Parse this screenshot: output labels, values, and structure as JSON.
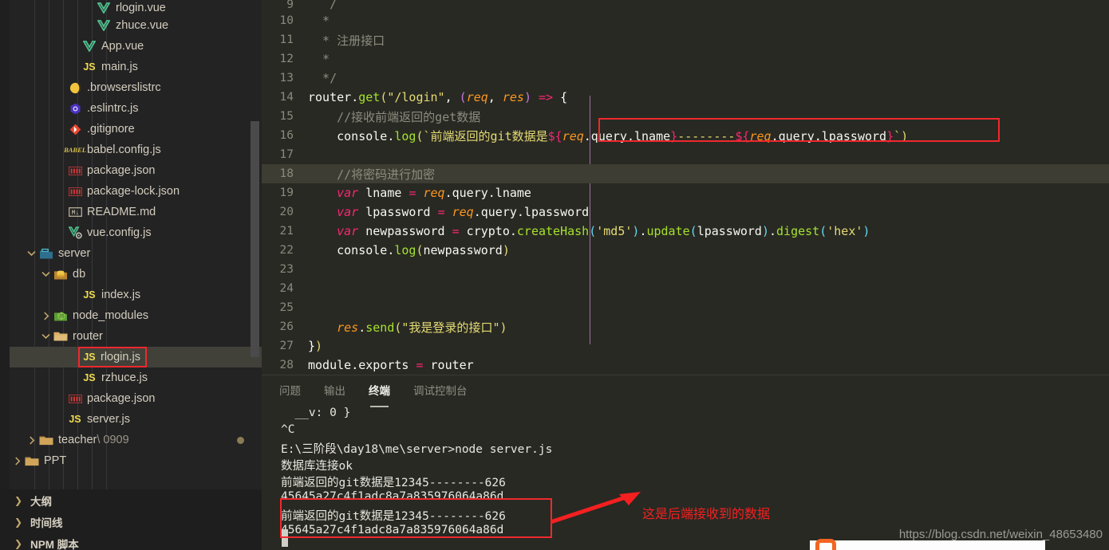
{
  "sidebar": {
    "tree": [
      {
        "label": "rlogin.vue",
        "icon": "vue-icon",
        "indent": 6,
        "twisty": "",
        "cut": true,
        "selected": false
      },
      {
        "label": "zhuce.vue",
        "icon": "vue-icon",
        "indent": 6,
        "twisty": "",
        "selected": false
      },
      {
        "label": "App.vue",
        "icon": "vue-icon",
        "indent": 5,
        "twisty": "",
        "selected": false
      },
      {
        "label": "main.js",
        "icon": "js-icon",
        "indent": 5,
        "twisty": "",
        "selected": false
      },
      {
        "label": ".browserslistrc",
        "icon": "browserslist-icon",
        "indent": 4,
        "twisty": "",
        "selected": false
      },
      {
        "label": ".eslintrc.js",
        "icon": "eslint-icon",
        "indent": 4,
        "twisty": "",
        "selected": false
      },
      {
        "label": ".gitignore",
        "icon": "git-icon",
        "indent": 4,
        "twisty": "",
        "selected": false
      },
      {
        "label": "babel.config.js",
        "icon": "babel-icon",
        "indent": 4,
        "twisty": "",
        "selected": false
      },
      {
        "label": "package.json",
        "icon": "npm-icon",
        "indent": 4,
        "twisty": "",
        "selected": false
      },
      {
        "label": "package-lock.json",
        "icon": "npm-icon",
        "indent": 4,
        "twisty": "",
        "selected": false
      },
      {
        "label": "README.md",
        "icon": "markdown-icon",
        "indent": 4,
        "twisty": "",
        "selected": false
      },
      {
        "label": "vue.config.js",
        "icon": "vue-config-icon",
        "indent": 4,
        "twisty": "",
        "selected": false
      },
      {
        "label": "server",
        "icon": "folder-server-icon",
        "indent": 2,
        "twisty": "chevron-down-icon",
        "selected": false
      },
      {
        "label": "db",
        "icon": "folder-db-icon",
        "indent": 3,
        "twisty": "chevron-down-icon",
        "selected": false
      },
      {
        "label": "index.js",
        "icon": "js-icon",
        "indent": 5,
        "twisty": "",
        "selected": false
      },
      {
        "label": "node_modules",
        "icon": "folder-node-icon",
        "indent": 3,
        "twisty": "chevron-right-icon",
        "selected": false
      },
      {
        "label": "router",
        "icon": "folder-open-icon",
        "indent": 3,
        "twisty": "chevron-down-icon",
        "selected": false
      },
      {
        "label": "rlogin.js",
        "icon": "js-icon",
        "indent": 5,
        "twisty": "",
        "selected": true,
        "outlined": true
      },
      {
        "label": "rzhuce.js",
        "icon": "js-icon",
        "indent": 5,
        "twisty": "",
        "selected": false
      },
      {
        "label": "package.json",
        "icon": "npm-icon",
        "indent": 4,
        "twisty": "",
        "selected": false
      },
      {
        "label": "server.js",
        "icon": "js-icon",
        "indent": 4,
        "twisty": "",
        "selected": false
      },
      {
        "label": "teacher",
        "label_dim": " \\ 0909",
        "icon": "folder-icon",
        "indent": 2,
        "twisty": "chevron-right-icon",
        "selected": false,
        "dirty_dot": true
      },
      {
        "label": "PPT",
        "icon": "folder-icon",
        "indent": 1,
        "twisty": "chevron-right-icon",
        "selected": false
      }
    ],
    "collapsed_sections": [
      {
        "label": "大纲",
        "twisty": "chevron-right-icon"
      },
      {
        "label": "时间线",
        "twisty": "chevron-right-icon"
      },
      {
        "label": "NPM 脚本",
        "twisty": "chevron-right-icon"
      }
    ]
  },
  "editor": {
    "first_line_number": 9,
    "active_line": 18,
    "lines": [
      {
        "n": 9,
        "segs": [
          {
            "t": "  ",
            "c": "t-plain"
          },
          {
            "t": " /",
            "c": "t-cmt"
          }
        ]
      },
      {
        "n": 10,
        "segs": [
          {
            "t": " ",
            "c": "t-plain"
          },
          {
            "t": " * ",
            "c": "t-cmt"
          }
        ]
      },
      {
        "n": 11,
        "segs": [
          {
            "t": " ",
            "c": "t-plain"
          },
          {
            "t": " * 注册接口",
            "c": "t-cmt"
          }
        ]
      },
      {
        "n": 12,
        "segs": [
          {
            "t": " ",
            "c": "t-plain"
          },
          {
            "t": " *",
            "c": "t-cmt"
          }
        ]
      },
      {
        "n": 13,
        "segs": [
          {
            "t": " ",
            "c": "t-plain"
          },
          {
            "t": " */",
            "c": "t-cmt"
          }
        ]
      },
      {
        "n": 14,
        "segs": [
          {
            "t": "router",
            "c": "t-plain"
          },
          {
            "t": ".",
            "c": "t-punct"
          },
          {
            "t": "get",
            "c": "t-fn"
          },
          {
            "t": "(",
            "c": "t-paren1"
          },
          {
            "t": "\"/login\"",
            "c": "t-str"
          },
          {
            "t": ", ",
            "c": "t-punct"
          },
          {
            "t": "(",
            "c": "t-paren2"
          },
          {
            "t": "req",
            "c": "t-param"
          },
          {
            "t": ", ",
            "c": "t-punct"
          },
          {
            "t": "res",
            "c": "t-param"
          },
          {
            "t": ")",
            "c": "t-paren2"
          },
          {
            "t": " => ",
            "c": "t-arrow"
          },
          {
            "t": "{",
            "c": "t-brace"
          }
        ]
      },
      {
        "n": 15,
        "segs": [
          {
            "t": "    //接收前端返回的get数据",
            "c": "t-cmt"
          }
        ]
      },
      {
        "n": 16,
        "segs": [
          {
            "t": "    console",
            "c": "t-plain"
          },
          {
            "t": ".",
            "c": "t-punct"
          },
          {
            "t": "log",
            "c": "t-fn"
          },
          {
            "t": "(",
            "c": "t-paren1"
          },
          {
            "t": "`前端返回的git数据是",
            "c": "t-str"
          },
          {
            "t": "$",
            "c": "t-dollar"
          },
          {
            "t": "{",
            "c": "t-key"
          },
          {
            "t": "req",
            "c": "t-param"
          },
          {
            "t": ".query.lname",
            "c": "t-plain"
          },
          {
            "t": "}",
            "c": "t-key"
          },
          {
            "t": "--------",
            "c": "t-str"
          },
          {
            "t": "$",
            "c": "t-dollar"
          },
          {
            "t": "{",
            "c": "t-key"
          },
          {
            "t": "req",
            "c": "t-param"
          },
          {
            "t": ".query.lpassword",
            "c": "t-plain"
          },
          {
            "t": "}",
            "c": "t-key"
          },
          {
            "t": "`",
            "c": "t-tick"
          },
          {
            "t": ")",
            "c": "t-paren1"
          }
        ]
      },
      {
        "n": 17,
        "segs": [
          {
            "t": "",
            "c": "t-plain"
          }
        ]
      },
      {
        "n": 18,
        "segs": [
          {
            "t": "    //将密码进行加密",
            "c": "t-cmt"
          }
        ]
      },
      {
        "n": 19,
        "segs": [
          {
            "t": "    ",
            "c": "t-plain"
          },
          {
            "t": "var",
            "c": "t-kw"
          },
          {
            "t": " lname ",
            "c": "t-plain"
          },
          {
            "t": "=",
            "c": "t-key"
          },
          {
            "t": " ",
            "c": "t-plain"
          },
          {
            "t": "req",
            "c": "t-param"
          },
          {
            "t": ".query.lname",
            "c": "t-plain"
          }
        ]
      },
      {
        "n": 20,
        "segs": [
          {
            "t": "    ",
            "c": "t-plain"
          },
          {
            "t": "var",
            "c": "t-kw"
          },
          {
            "t": " lpassword ",
            "c": "t-plain"
          },
          {
            "t": "=",
            "c": "t-key"
          },
          {
            "t": " ",
            "c": "t-plain"
          },
          {
            "t": "req",
            "c": "t-param"
          },
          {
            "t": ".query.lpassword",
            "c": "t-plain"
          }
        ]
      },
      {
        "n": 21,
        "segs": [
          {
            "t": "    ",
            "c": "t-plain"
          },
          {
            "t": "var",
            "c": "t-kw"
          },
          {
            "t": " newpassword ",
            "c": "t-plain"
          },
          {
            "t": "=",
            "c": "t-key"
          },
          {
            "t": " crypto",
            "c": "t-plain"
          },
          {
            "t": ".",
            "c": "t-punct"
          },
          {
            "t": "createHash",
            "c": "t-fn"
          },
          {
            "t": "(",
            "c": "t-obj"
          },
          {
            "t": "'md5'",
            "c": "t-str"
          },
          {
            "t": ")",
            "c": "t-obj"
          },
          {
            "t": ".",
            "c": "t-punct"
          },
          {
            "t": "update",
            "c": "t-fn"
          },
          {
            "t": "(",
            "c": "t-obj"
          },
          {
            "t": "lpassword",
            "c": "t-plain"
          },
          {
            "t": ")",
            "c": "t-obj"
          },
          {
            "t": ".",
            "c": "t-punct"
          },
          {
            "t": "digest",
            "c": "t-fn"
          },
          {
            "t": "(",
            "c": "t-obj"
          },
          {
            "t": "'hex'",
            "c": "t-str"
          },
          {
            "t": ")",
            "c": "t-obj"
          }
        ]
      },
      {
        "n": 22,
        "segs": [
          {
            "t": "    console",
            "c": "t-plain"
          },
          {
            "t": ".",
            "c": "t-punct"
          },
          {
            "t": "log",
            "c": "t-fn"
          },
          {
            "t": "(",
            "c": "t-paren1"
          },
          {
            "t": "newpassword",
            "c": "t-plain"
          },
          {
            "t": ")",
            "c": "t-paren1"
          }
        ]
      },
      {
        "n": 23,
        "segs": [
          {
            "t": "",
            "c": "t-plain"
          }
        ]
      },
      {
        "n": 24,
        "segs": [
          {
            "t": "",
            "c": "t-plain"
          }
        ]
      },
      {
        "n": 25,
        "segs": [
          {
            "t": "",
            "c": "t-plain"
          }
        ]
      },
      {
        "n": 26,
        "segs": [
          {
            "t": "    ",
            "c": "t-plain"
          },
          {
            "t": "res",
            "c": "t-param"
          },
          {
            "t": ".",
            "c": "t-punct"
          },
          {
            "t": "send",
            "c": "t-fn"
          },
          {
            "t": "(",
            "c": "t-paren1"
          },
          {
            "t": "\"我是登录的接口\"",
            "c": "t-str"
          },
          {
            "t": ")",
            "c": "t-paren1"
          }
        ]
      },
      {
        "n": 27,
        "segs": [
          {
            "t": "}",
            "c": "t-brace"
          },
          {
            "t": ")",
            "c": "t-paren1"
          }
        ]
      },
      {
        "n": 28,
        "segs": [
          {
            "t": "module",
            "c": "t-plain"
          },
          {
            "t": ".exports ",
            "c": "t-plain"
          },
          {
            "t": "=",
            "c": "t-key"
          },
          {
            "t": " router",
            "c": "t-plain"
          }
        ]
      }
    ],
    "highlight_box_label": "template-literal-highlight"
  },
  "panel": {
    "tabs": [
      {
        "label": "问题",
        "active": false
      },
      {
        "label": "输出",
        "active": false
      },
      {
        "label": "终端",
        "active": true
      },
      {
        "label": "调试控制台",
        "active": false
      }
    ],
    "terminal_lines": [
      "  __v: 0 }",
      "^C",
      "E:\\三阶段\\day18\\me\\server>node server.js",
      "数据库连接ok",
      "前端返回的git数据是12345--------626",
      "45645a27c4f1adc8a7a835976064a86d",
      "前端返回的git数据是12345--------626",
      "45645a27c4f1adc8a7a835976064a86d"
    ]
  },
  "annotations": {
    "arrow_label": "red-arrow",
    "text": "这是后端接收到的数据",
    "text_color": "#f42020",
    "box_color": "#f0282d"
  },
  "watermark": {
    "text": "https://blog.csdn.net/weixin_48653480"
  }
}
